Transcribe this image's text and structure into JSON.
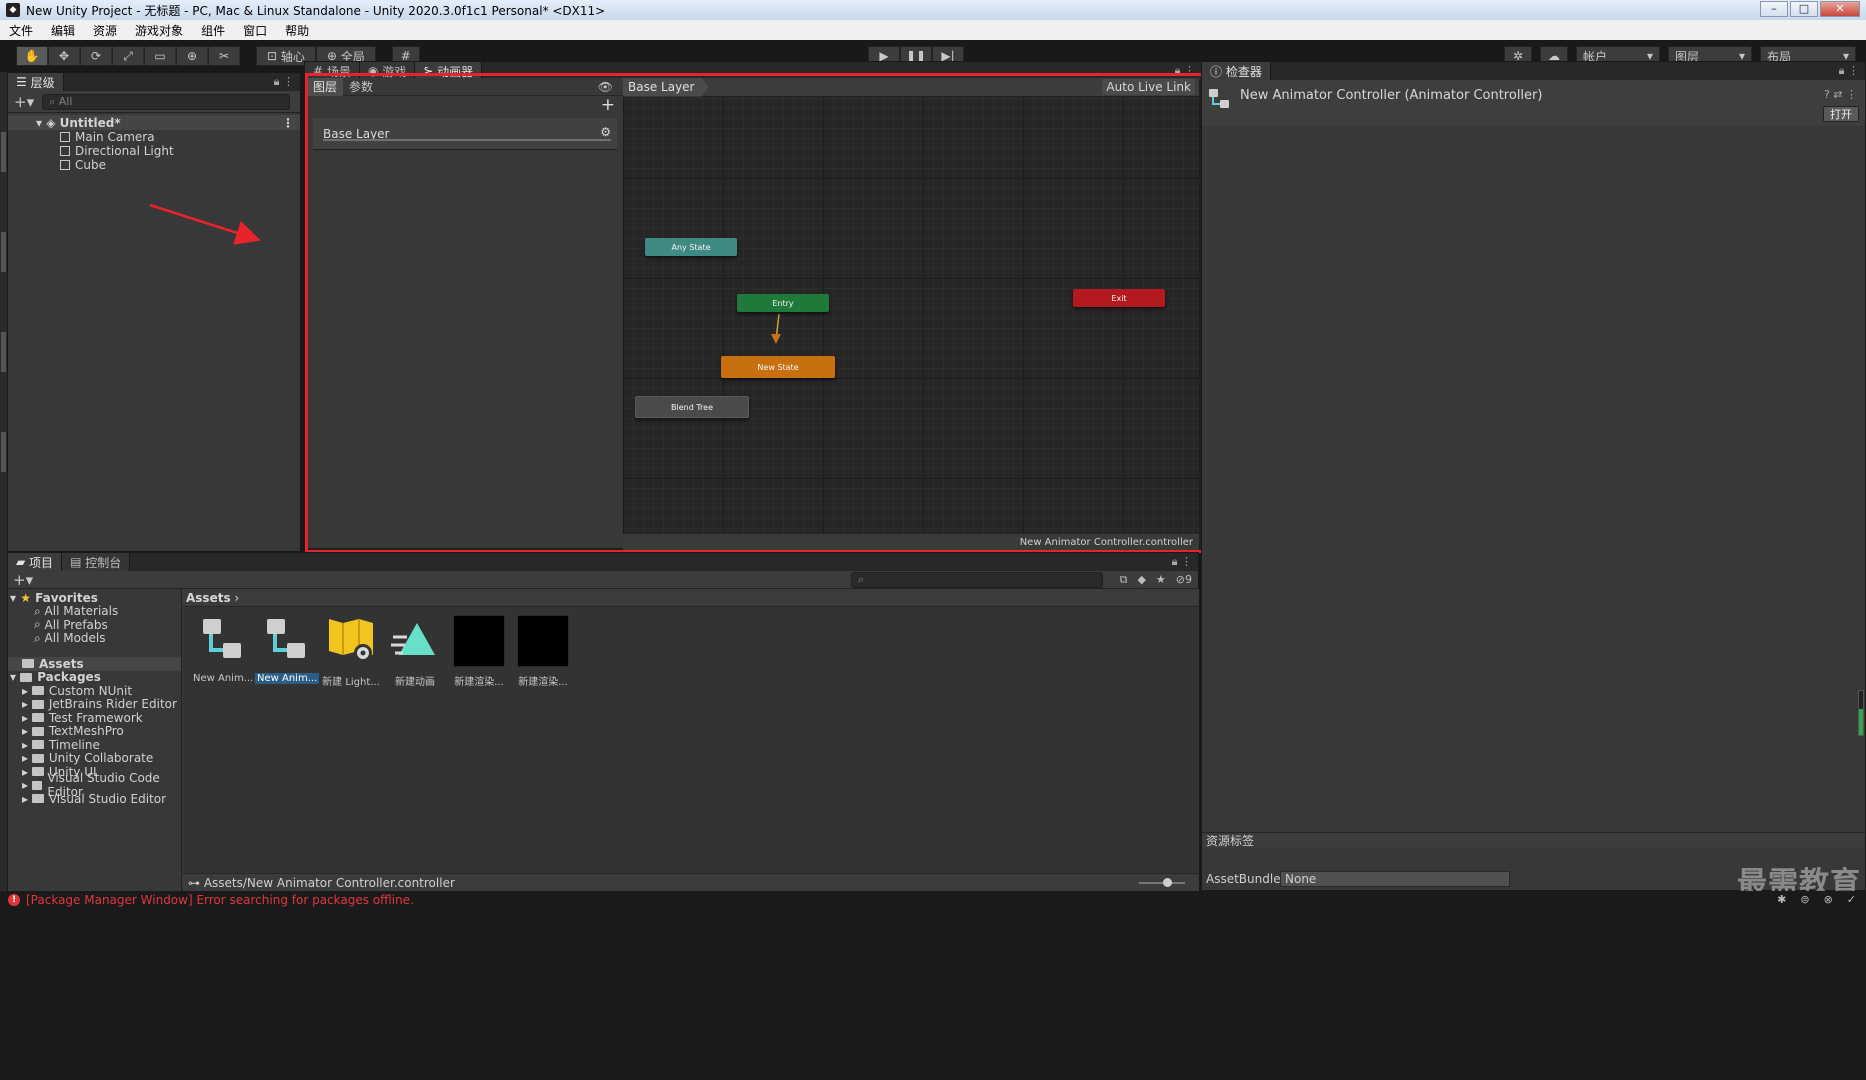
{
  "window": {
    "title": "New Unity Project - 无标题 - PC, Mac & Linux Standalone - Unity 2020.3.0f1c1 Personal* <DX11>"
  },
  "menu": [
    "文件",
    "编辑",
    "资源",
    "游戏对象",
    "组件",
    "窗口",
    "帮助"
  ],
  "toolbar": {
    "pivot_label": "轴心",
    "global_label": "全局",
    "account_label": "帐户",
    "layers_label": "图层",
    "layout_label": "布局"
  },
  "hierarchy": {
    "tab_label": "层级",
    "search_placeholder": "All",
    "scene_name": "Untitled*",
    "items": [
      "Main Camera",
      "Directional Light",
      "Cube"
    ]
  },
  "animator": {
    "tabs": [
      "场景",
      "游戏",
      "动画器"
    ],
    "subtabs": [
      "图层",
      "参数"
    ],
    "layer_name": "Base Layer",
    "breadcrumb": "Base Layer",
    "auto_live_link": "Auto Live Link",
    "footer_file": "New Animator Controller.controller",
    "nodes": {
      "any_state": "Any State",
      "entry": "Entry",
      "exit": "Exit",
      "new_state": "New State",
      "blend_tree": "Blend Tree"
    },
    "colors": {
      "any_state": "#3f8b82",
      "entry": "#1f7a3a",
      "exit": "#b3191f",
      "new_state": "#c8700f",
      "blend_tree": "#4a4a4a",
      "frame": "#e8242b"
    }
  },
  "inspector": {
    "tab_label": "检查器",
    "title": "New Animator Controller (Animator Controller)",
    "open_button": "打开",
    "asset_labels": "资源标签",
    "assetbundle_label": "AssetBundle",
    "assetbundle_value": "None",
    "watermark": "最需教育"
  },
  "project": {
    "tabs": [
      "项目",
      "控制台"
    ],
    "hidden_count": "9",
    "favorites_label": "Favorites",
    "favorites": [
      "All Materials",
      "All Prefabs",
      "All Models"
    ],
    "assets_label": "Assets",
    "packages_label": "Packages",
    "packages": [
      "Custom NUnit",
      "JetBrains Rider Editor",
      "Test Framework",
      "TextMeshPro",
      "Timeline",
      "Unity Collaborate",
      "Unity UI",
      "Visual Studio Code Editor",
      "Visual Studio Editor"
    ],
    "breadcrumb": "Assets",
    "assets": [
      {
        "label": "New Anim...",
        "selected": false
      },
      {
        "label": "New Anim...",
        "selected": true
      },
      {
        "label": "新建 Light...",
        "selected": false
      },
      {
        "label": "新建动画",
        "selected": false
      },
      {
        "label": "新建渲染...",
        "selected": false
      },
      {
        "label": "新建渲染...",
        "selected": false
      }
    ],
    "path": "Assets/New Animator Controller.controller"
  },
  "status": {
    "message": "[Package Manager Window] Error searching for packages offline."
  }
}
